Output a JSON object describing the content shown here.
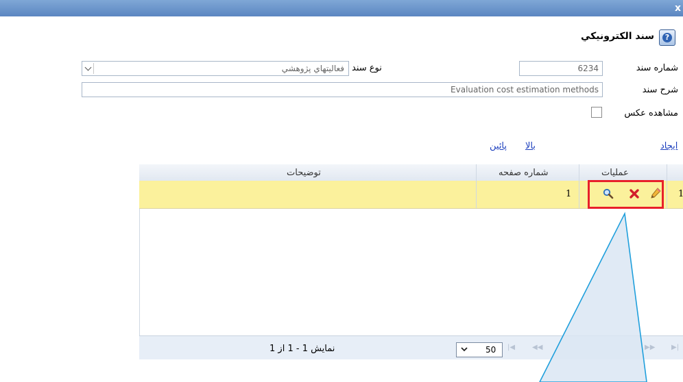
{
  "page": {
    "title": "سند الكترونيكي",
    "close_glyph": "x",
    "help_icon": "?"
  },
  "form": {
    "doc_number_label": "شماره سند",
    "doc_number_value": "6234",
    "doc_type_label": "نوع سند",
    "doc_type_value": "فعاليتهاي پژوهشي",
    "doc_desc_label": "شرح سند",
    "doc_desc_value": "Evaluation cost estimation methods",
    "reverse_view_label": "مشاهده عكس"
  },
  "links": {
    "create": "ايجاد",
    "up": "بالا",
    "down": "پائين"
  },
  "grid": {
    "columns": [
      "عمليات",
      "شماره صفحه",
      "توضيحات"
    ],
    "rows": [
      {
        "index": "1",
        "page_number": "1",
        "description": ""
      }
    ],
    "row_highlight_color": "#fbf19c",
    "highlight_border_color": "#e8202b"
  },
  "pager": {
    "page_size": "50",
    "info": "نمايش 1 - 1 از 1"
  },
  "callout": {
    "fill_color": "#dbe6f3",
    "stroke_color": "#1f9fdc"
  }
}
